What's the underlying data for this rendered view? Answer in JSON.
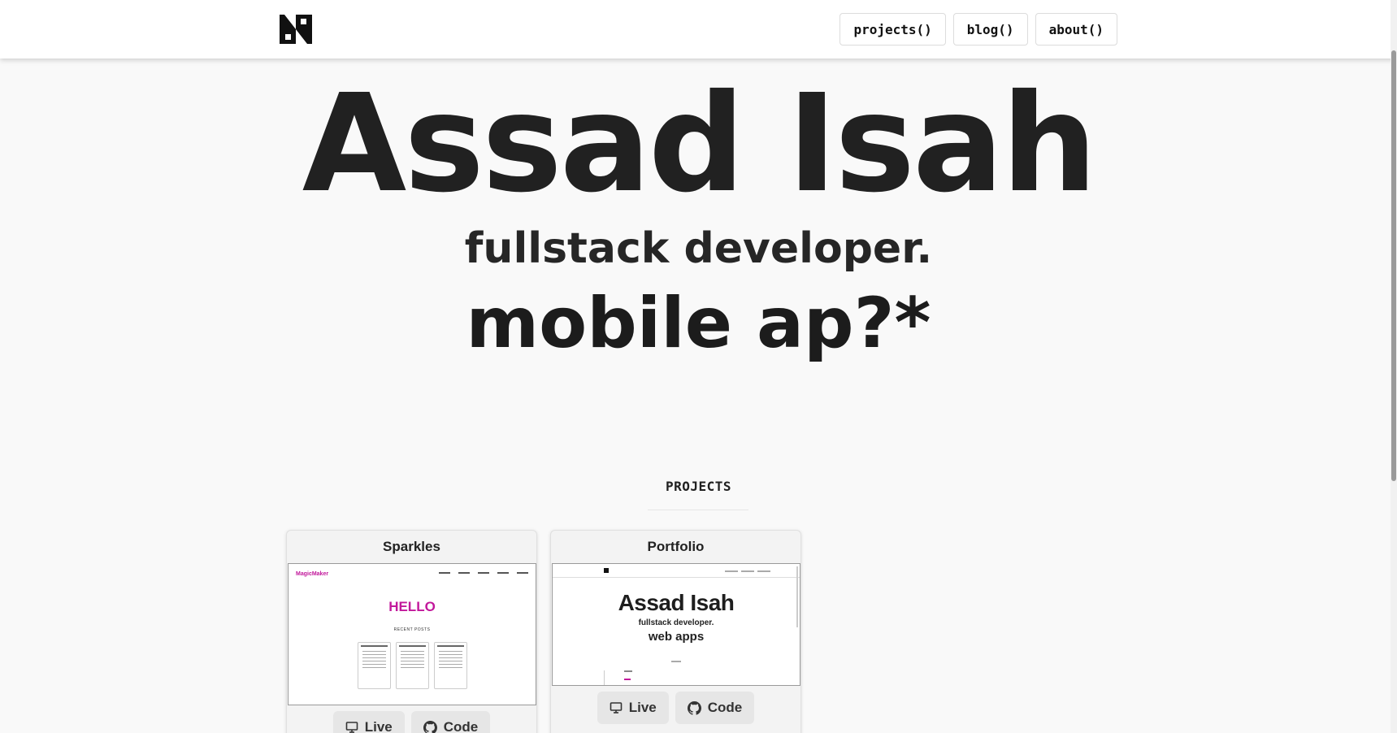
{
  "nav": {
    "items": [
      {
        "label": "projects()"
      },
      {
        "label": "blog()"
      },
      {
        "label": "about()"
      }
    ]
  },
  "hero": {
    "name": "Assad Isah",
    "role": "fullstack developer.",
    "typing": "mobile ap?*"
  },
  "projects": {
    "title": "PROJECTS",
    "cards": [
      {
        "title": "Sparkles",
        "preview": {
          "heading": "HELLO",
          "subheading": "RECENT POSTS"
        },
        "live_label": "Live",
        "code_label": "Code"
      },
      {
        "title": "Portfolio",
        "preview": {
          "name": "Assad Isah",
          "role": "fullstack developer.",
          "typing": "web apps"
        },
        "live_label": "Live",
        "code_label": "Code"
      }
    ]
  },
  "colors": {
    "background": "#f9f9f9",
    "text": "#212121",
    "accent": "#c2189b",
    "button": "#e6e6e6"
  },
  "icons": {
    "logo": "brand-monogram-icon",
    "live": "monitor-icon",
    "code": "github-icon"
  }
}
